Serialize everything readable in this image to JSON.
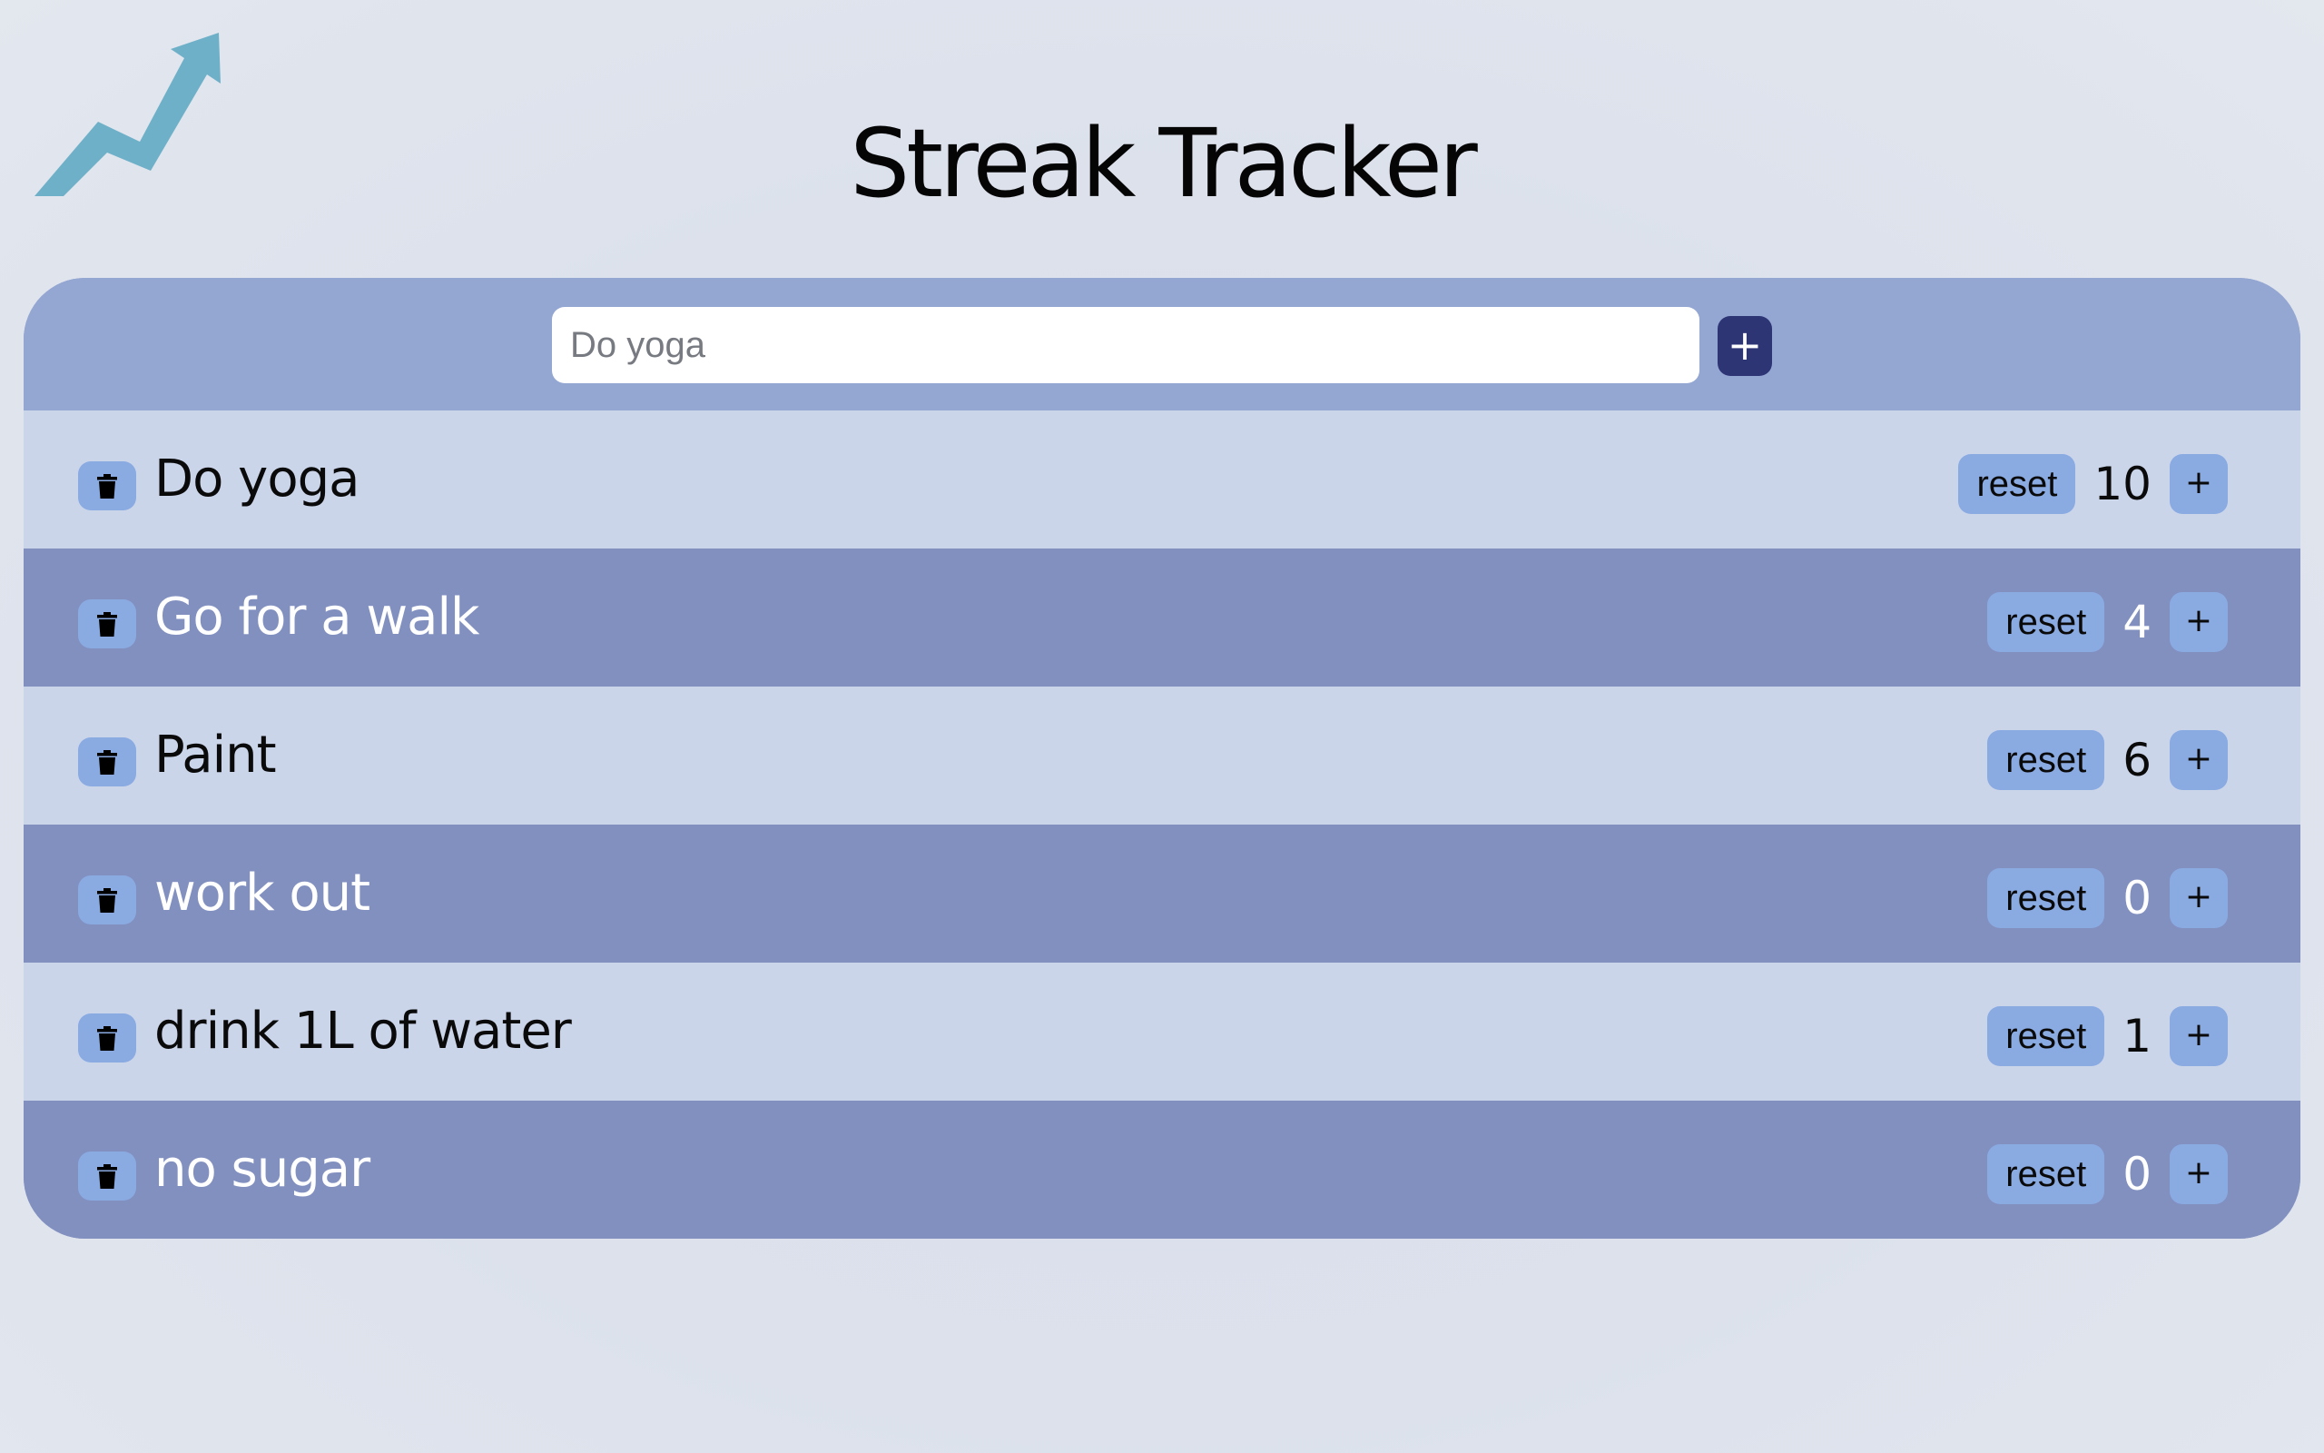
{
  "app": {
    "title": "Streak Tracker",
    "logo_icon": "trending-up-arrow-icon",
    "accent_color": "#2e3575",
    "logo_color": "#6fb0c9"
  },
  "new_habit": {
    "placeholder": "Do yoga",
    "value": "",
    "add_label": "+"
  },
  "habits": [
    {
      "name": "Do yoga",
      "count": "10",
      "reset_label": "reset",
      "increment_label": "+"
    },
    {
      "name": "Go for a walk",
      "count": "4",
      "reset_label": "reset",
      "increment_label": "+"
    },
    {
      "name": "Paint",
      "count": "6",
      "reset_label": "reset",
      "increment_label": "+"
    },
    {
      "name": "work out",
      "count": "0",
      "reset_label": "reset",
      "increment_label": "+"
    },
    {
      "name": "drink 1L of water",
      "count": "1",
      "reset_label": "reset",
      "increment_label": "+"
    },
    {
      "name": "no sugar",
      "count": "0",
      "reset_label": "reset",
      "increment_label": "+"
    }
  ],
  "icons": {
    "delete": "trash-icon"
  },
  "colors": {
    "row_light": "#cbd5ea",
    "row_dark": "#8290c0",
    "button": "#8aaae2",
    "header": "#94a7d3"
  }
}
